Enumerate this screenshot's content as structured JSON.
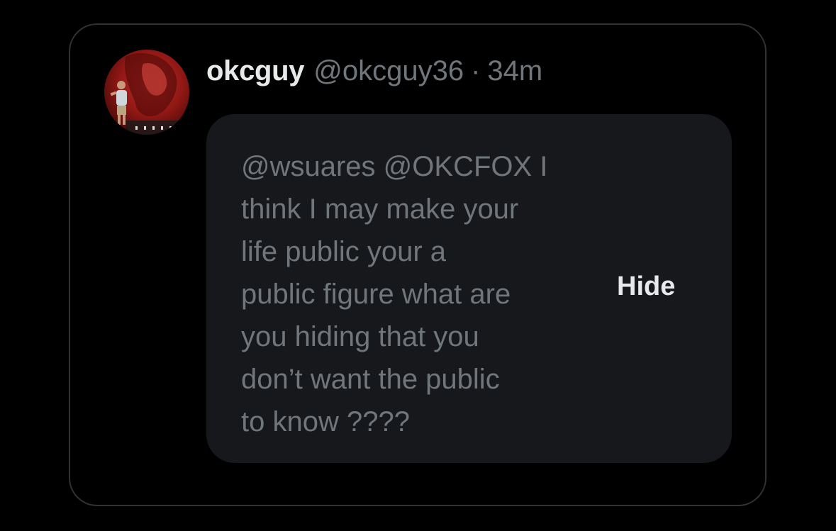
{
  "tweet": {
    "display_name": "okcguy",
    "handle": "@okcguy36",
    "separator": "·",
    "time": "34m",
    "avatar": "profile-photo",
    "hidden_reply": {
      "text": "@wsuares @OKCFOX I\nthink I may make your\nlife public your a\npublic figure what are\nyou hiding that you\ndon’t want the public\nto know ????",
      "hide_label": "Hide"
    }
  },
  "colors": {
    "background": "#000000",
    "card_border": "#2f3336",
    "box_background": "#16181c",
    "primary_text": "#e7e9ea",
    "secondary_text": "#71767b"
  }
}
